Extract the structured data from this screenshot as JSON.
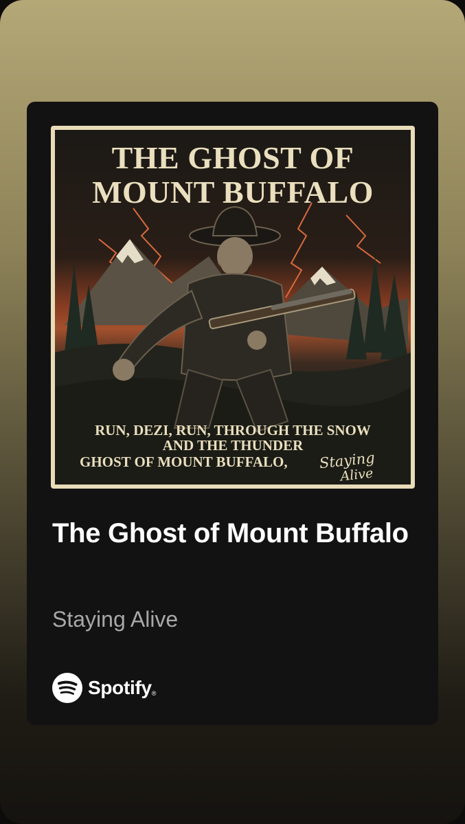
{
  "card": {
    "artwork": {
      "title_line1": "THE GHOST OF",
      "title_line2": "MOUNT BUFFALO",
      "lyric_line1": "RUN, DEZI, RUN, THROUGH THE SNOW",
      "lyric_line2": "AND THE THUNDER",
      "lyric_line3": "GHOST OF MOUNT BUFFALO,",
      "signature_line1": "Staying",
      "signature_line2": "Alive"
    },
    "track_title": "The Ghost of Mount Buffalo",
    "artist": "Staying Alive",
    "brand": {
      "name": "Spotify",
      "trademark": "®",
      "icon": "spotify-logo-icon"
    }
  },
  "colors": {
    "card_background": "#121212",
    "title_text": "#ffffff",
    "artist_text": "#a8a8a8",
    "poster_ink": "#eadfbe",
    "poster_frame": "#e8dcb8",
    "sky_glow": "#b5542c"
  }
}
